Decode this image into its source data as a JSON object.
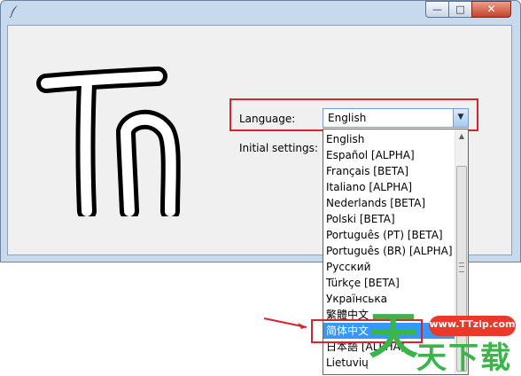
{
  "window": {
    "icon": "feather-icon",
    "controls": {
      "minimize": "—",
      "maximize": "□",
      "close": "✕"
    }
  },
  "logo_text": "Th",
  "language_label": "Language:",
  "language_value": "English",
  "initial_settings_label": "Initial settings:",
  "dropdown_arrow": "▼",
  "scroll_up": "▲",
  "languages": [
    {
      "label": "English"
    },
    {
      "label": "Español [ALPHA]"
    },
    {
      "label": "Français [BETA]"
    },
    {
      "label": "Italiano [ALPHA]"
    },
    {
      "label": "Nederlands [BETA]"
    },
    {
      "label": "Polski [BETA]"
    },
    {
      "label": "Português (PT) [BETA]"
    },
    {
      "label": "Português (BR) [ALPHA]"
    },
    {
      "label": "Русский"
    },
    {
      "label": "Türkçe [BETA]"
    },
    {
      "label": "Українська"
    },
    {
      "label": "繁體中文"
    },
    {
      "label": "简体中文",
      "selected": true
    },
    {
      "label": "日本語 [ALPHA]"
    },
    {
      "label": "Lietuvių"
    }
  ],
  "watermark": {
    "url": "www.TTzip.com",
    "big_char": "天",
    "small_text": "天下载",
    "color": "#39b54a",
    "bubble_color": "#e8392b"
  },
  "highlight_color": "#d4262c",
  "selection_color": "#3399ff"
}
